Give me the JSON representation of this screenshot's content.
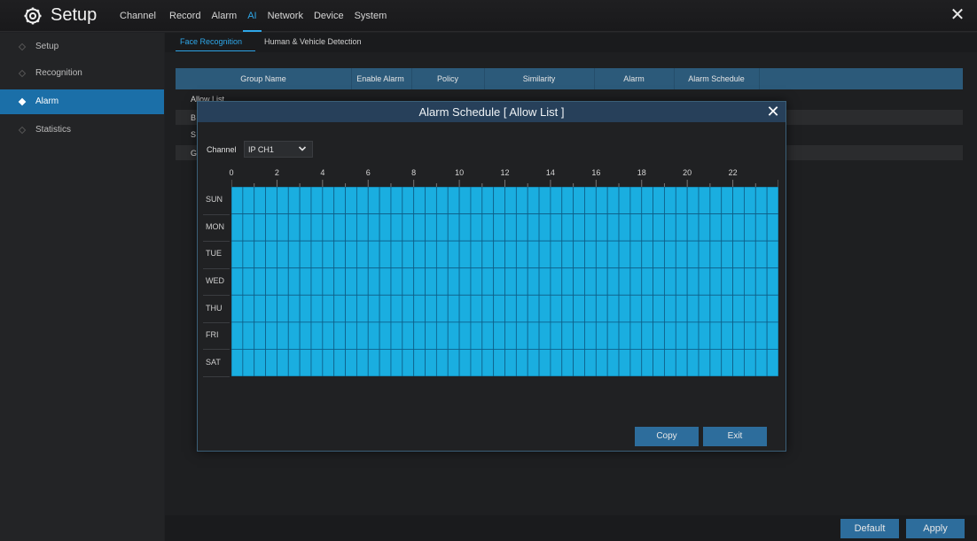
{
  "header": {
    "title": "Setup",
    "nav": [
      "Channel",
      "Record",
      "Alarm",
      "AI",
      "Network",
      "Device",
      "System"
    ],
    "active_nav": "AI"
  },
  "sidebar": {
    "items": [
      {
        "label": "Setup"
      },
      {
        "label": "Recognition"
      },
      {
        "label": "Alarm"
      },
      {
        "label": "Statistics"
      }
    ],
    "active": "Alarm"
  },
  "subtabs": [
    "Face Recognition",
    "Human & Vehicle Detection"
  ],
  "table": {
    "headers": [
      "Group Name",
      "Enable Alarm",
      "Policy",
      "Similarity",
      "Alarm",
      "Alarm Schedule"
    ],
    "rows": [
      {
        "group": "Allow List"
      },
      {
        "group": "B"
      },
      {
        "group": "S"
      },
      {
        "group": "G"
      }
    ]
  },
  "bottom": {
    "default_label": "Default",
    "apply_label": "Apply"
  },
  "modal": {
    "title": "Alarm Schedule [ Allow List ]",
    "channel_label": "Channel",
    "channel_value": "IP CH1",
    "hours": [
      "0",
      "2",
      "4",
      "6",
      "8",
      "10",
      "12",
      "14",
      "16",
      "18",
      "20",
      "22"
    ],
    "days": [
      "SUN",
      "MON",
      "TUE",
      "WED",
      "THU",
      "FRI",
      "SAT"
    ],
    "schedule_all_enabled": true,
    "schedule_color": "#1aaee0",
    "copy_label": "Copy",
    "exit_label": "Exit"
  },
  "colors": {
    "accent": "#2ea6e8",
    "sidebar_active": "#1b6fa8",
    "button": "#2d6d9c"
  }
}
